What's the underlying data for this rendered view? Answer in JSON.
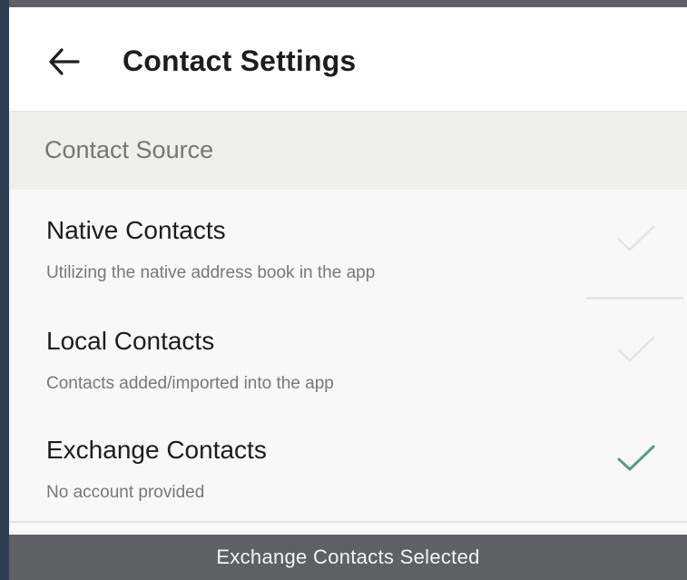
{
  "header": {
    "back_icon": "arrow-left-icon",
    "title": "Contact Settings"
  },
  "section": {
    "title": "Contact Source"
  },
  "sources": [
    {
      "title": "Native Contacts",
      "subtitle": "Utilizing the native address book in the app",
      "selected": false,
      "check_icon": "checkmark-icon"
    },
    {
      "title": "Local Contacts",
      "subtitle": "Contacts added/imported into the app",
      "selected": false,
      "check_icon": "checkmark-icon"
    },
    {
      "title": "Exchange Contacts",
      "subtitle": "No account provided",
      "selected": true,
      "check_icon": "checkmark-icon"
    }
  ],
  "caption": "Exchange Contacts Selected",
  "colors": {
    "selected_check": "#5a9a86",
    "unselected_check": "#e2e3e2",
    "caption_bar": "#5e6064",
    "left_accent": "#2e3e52"
  }
}
